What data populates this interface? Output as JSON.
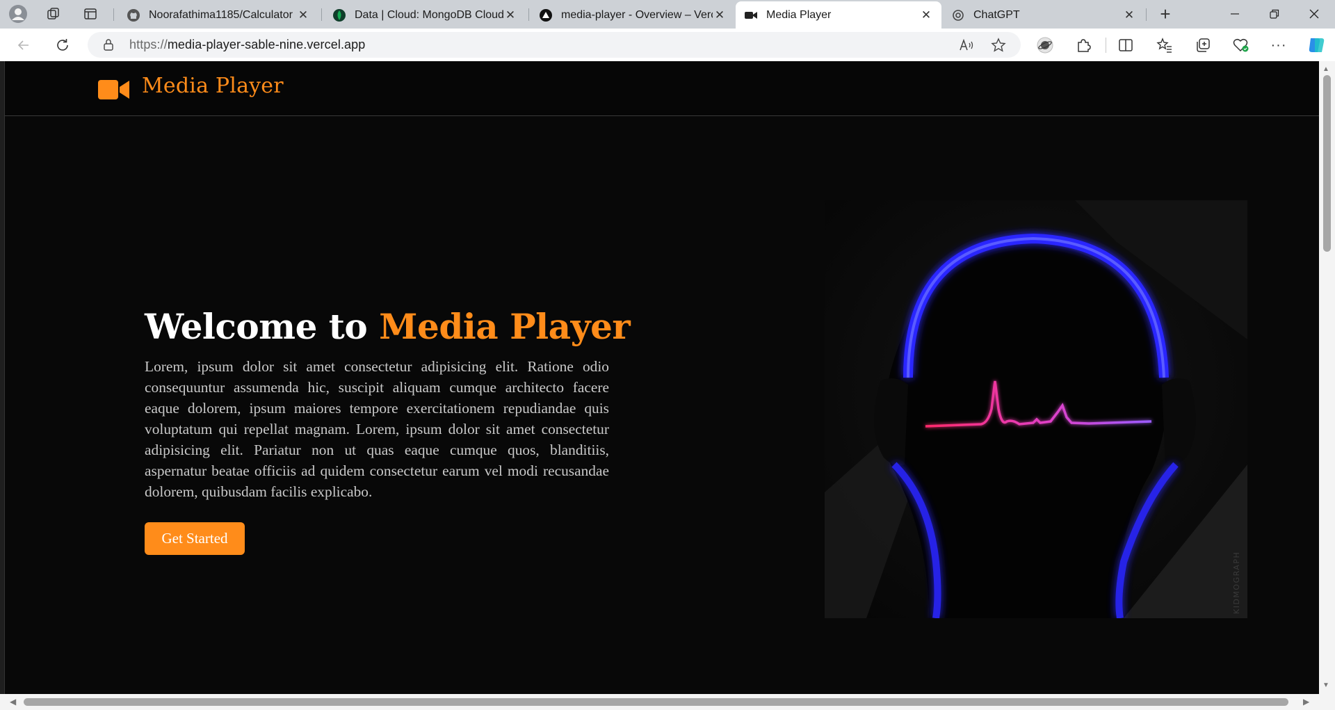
{
  "browser": {
    "tabs": [
      {
        "title": "Noorafathima1185/Calculator",
        "icon": "github-icon"
      },
      {
        "title": "Data | Cloud: MongoDB Cloud",
        "icon": "mongodb-leaf-icon"
      },
      {
        "title": "media-player - Overview – Vercel",
        "icon": "vercel-triangle-icon"
      },
      {
        "title": "Media Player",
        "icon": "video-camera-icon",
        "active": true
      },
      {
        "title": "ChatGPT",
        "icon": "openai-icon"
      }
    ],
    "new_tab_label": "+",
    "url_protocol": "https://",
    "url_host": "media-player-sable-nine.vercel.app"
  },
  "site": {
    "logo_text": "Media Player",
    "accent_color": "#ff8c1a",
    "hero": {
      "title_prefix": "Welcome to ",
      "title_accent": "Media Player",
      "body": "Lorem, ipsum dolor sit amet consectetur adipisicing elit. Ratione odio consequuntur assumenda hic, suscipit aliquam cumque architecto facere eaque dolorem, ipsum maiores tempore exercitationem repudiandae quis voluptatum qui repellat magnam. Lorem, ipsum dolor sit amet consectetur adipisicing elit. Pariatur non ut quas eaque cumque quos, blanditiis, aspernatur beatae officiis ad quidem consectetur earum vel modi recusandae dolorem, quibusdam facilis explicabo.",
      "cta_label": "Get Started",
      "image_watermark": "KIDMOGRAPH"
    }
  }
}
